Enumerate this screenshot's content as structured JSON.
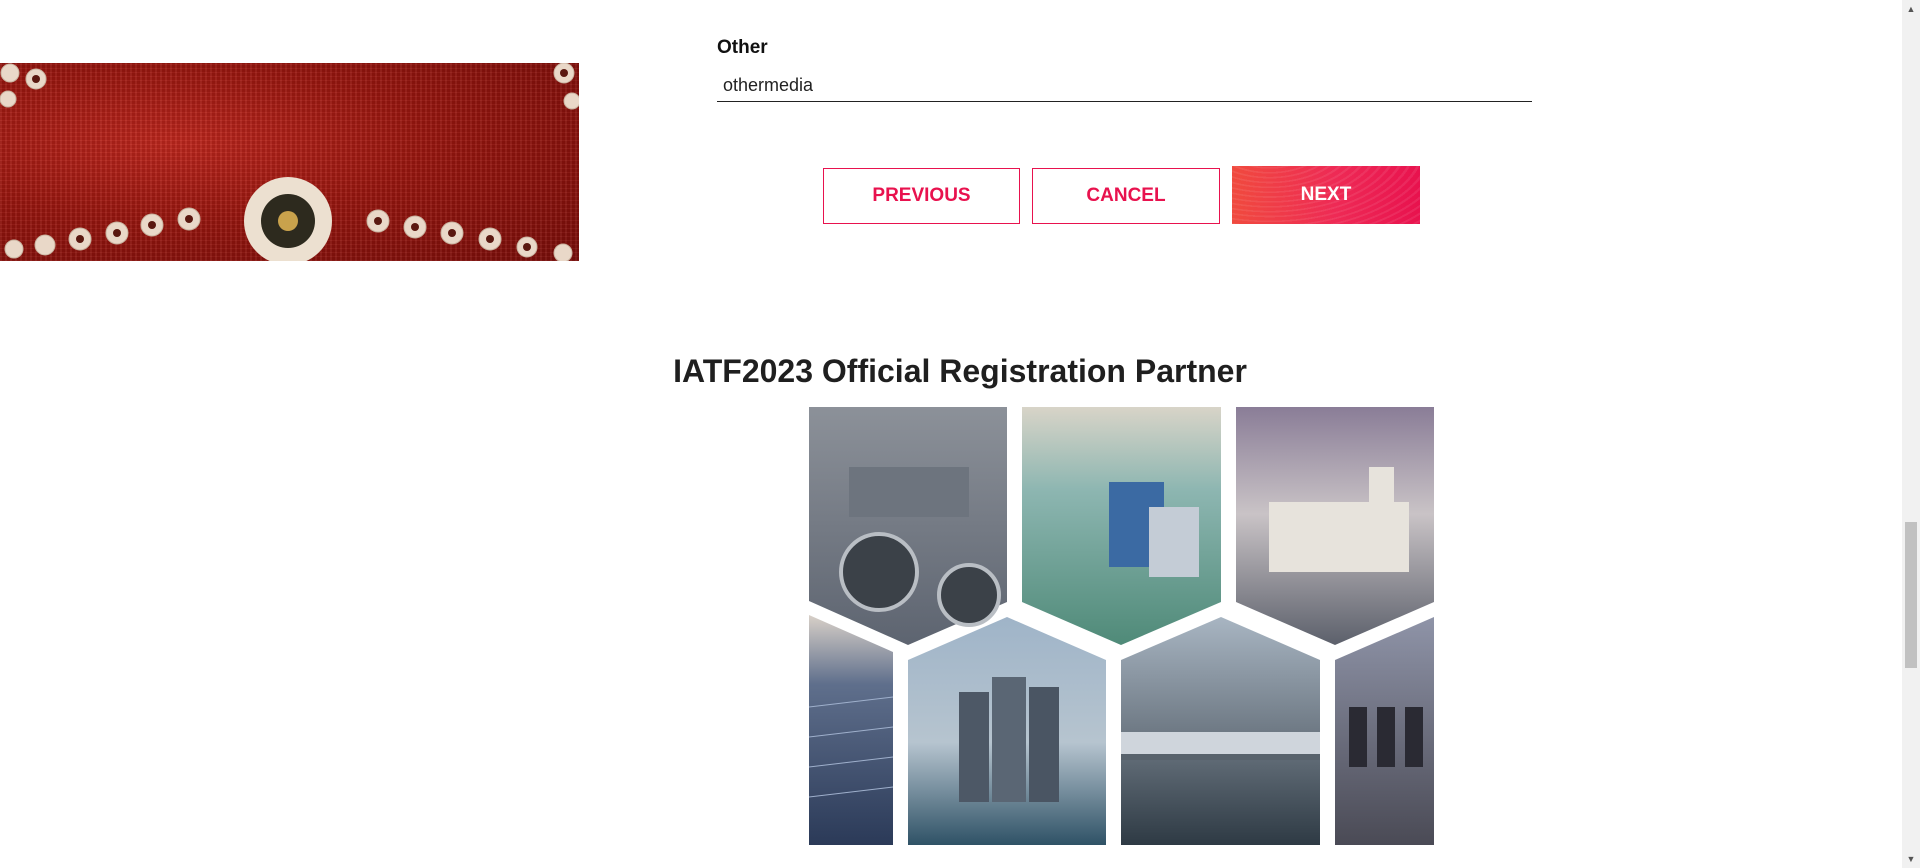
{
  "form": {
    "other_label": "Other",
    "other_value": "othermedia"
  },
  "buttons": {
    "previous": "PREVIOUS",
    "cancel": "CANCEL",
    "next": "NEXT"
  },
  "partner": {
    "title": "IATF2023 Official Registration Partner"
  },
  "colors": {
    "accent": "#e8124e",
    "banner": "#9a160f"
  },
  "icons": {
    "scroll_up": "chevron-up-icon",
    "scroll_down": "chevron-down-icon"
  }
}
